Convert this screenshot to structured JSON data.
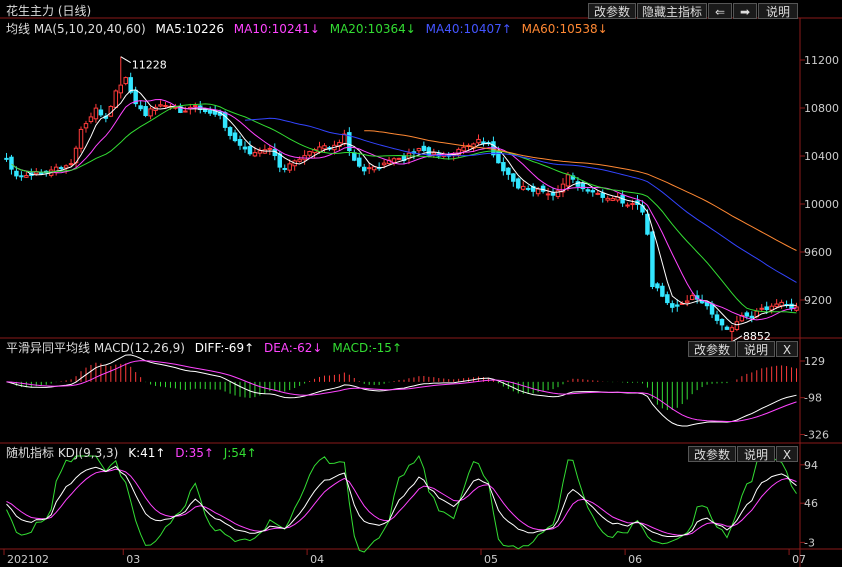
{
  "title": "花生主力 (日线)",
  "toolbar": {
    "edit_params": "改参数",
    "hide_indicator": "隐藏主指标",
    "explain": "说明",
    "left_arrow": "⇐",
    "right_arrow": "➡"
  },
  "main_legend": {
    "ma_label": "均线 MA(5,10,20,40,60)",
    "ma5": "MA5:10226",
    "ma10": "MA10:10241↓",
    "ma20": "MA20:10364↓",
    "ma40": "MA40:10407↑",
    "ma60": "MA60:10538↓"
  },
  "macd_legend": {
    "label": "平滑异同平均线 MACD(12,26,9)",
    "diff": "DIFF:-69↑",
    "dea": "DEA:-62↓",
    "macd": "MACD:-15↑",
    "edit_params": "改参数",
    "explain": "说明",
    "close": "X"
  },
  "kdj_legend": {
    "label": "随机指标 KDJ(9,3,3)",
    "k": "K:41↑",
    "d": "D:35↑",
    "j": "J:54↑",
    "edit_params": "改参数",
    "explain": "说明",
    "close": "X"
  },
  "colors": {
    "up": "#ff3b3b",
    "down": "#33e6ff",
    "ma5": "#ffffff",
    "ma10": "#ff44ff",
    "ma20": "#33dd33",
    "ma40": "#3344ff",
    "ma60": "#ff8833",
    "macd_pos": "#ff3b3b",
    "macd_neg": "#33dd33",
    "diff": "#ffffff",
    "dea": "#ff44ff",
    "kdj_k": "#ffffff",
    "kdj_d": "#ff44ff",
    "kdj_j": "#33dd33",
    "grid": "#8a1a1a"
  },
  "chart_data": [
    {
      "type": "candlestick",
      "ylim": [
        8900,
        11400
      ],
      "yticks": [
        9200,
        9600,
        10000,
        10400,
        10800,
        11200
      ],
      "annotations": [
        {
          "text": "11228",
          "value": 11228,
          "index": 23
        },
        {
          "text": "8852",
          "value": 8852,
          "index": 146
        }
      ],
      "x_month_labels": [
        {
          "label": "202102",
          "index": 0
        },
        {
          "label": "03",
          "index": 24
        },
        {
          "label": "04",
          "index": 61
        },
        {
          "label": "05",
          "index": 96
        },
        {
          "label": "06",
          "index": 125
        },
        {
          "label": "07",
          "index": 158
        }
      ],
      "count": 160,
      "anchors_close": [
        [
          0,
          10380
        ],
        [
          2,
          10240
        ],
        [
          5,
          10250
        ],
        [
          10,
          10300
        ],
        [
          13,
          10330
        ],
        [
          15,
          10620
        ],
        [
          18,
          10780
        ],
        [
          20,
          10720
        ],
        [
          22,
          10930
        ],
        [
          23,
          11000
        ],
        [
          24,
          11050
        ],
        [
          26,
          10830
        ],
        [
          28,
          10750
        ],
        [
          30,
          10800
        ],
        [
          33,
          10830
        ],
        [
          35,
          10750
        ],
        [
          38,
          10830
        ],
        [
          40,
          10780
        ],
        [
          43,
          10740
        ],
        [
          45,
          10560
        ],
        [
          48,
          10450
        ],
        [
          50,
          10420
        ],
        [
          53,
          10480
        ],
        [
          55,
          10300
        ],
        [
          57,
          10320
        ],
        [
          60,
          10420
        ],
        [
          63,
          10460
        ],
        [
          66,
          10480
        ],
        [
          68,
          10570
        ],
        [
          70,
          10360
        ],
        [
          72,
          10290
        ],
        [
          75,
          10300
        ],
        [
          78,
          10370
        ],
        [
          80,
          10380
        ],
        [
          83,
          10460
        ],
        [
          85,
          10420
        ],
        [
          88,
          10400
        ],
        [
          90,
          10420
        ],
        [
          93,
          10500
        ],
        [
          95,
          10530
        ],
        [
          97,
          10500
        ],
        [
          99,
          10330
        ],
        [
          101,
          10230
        ],
        [
          103,
          10150
        ],
        [
          105,
          10120
        ],
        [
          107,
          10130
        ],
        [
          109,
          10080
        ],
        [
          111,
          10100
        ],
        [
          113,
          10250
        ],
        [
          115,
          10150
        ],
        [
          117,
          10100
        ],
        [
          119,
          10100
        ],
        [
          121,
          10030
        ],
        [
          123,
          10050
        ],
        [
          125,
          10000
        ],
        [
          127,
          10000
        ],
        [
          128,
          9930
        ],
        [
          129,
          9760
        ],
        [
          130,
          9320
        ],
        [
          132,
          9250
        ],
        [
          134,
          9130
        ],
        [
          136,
          9170
        ],
        [
          138,
          9220
        ],
        [
          140,
          9180
        ],
        [
          142,
          9100
        ],
        [
          144,
          8990
        ],
        [
          146,
          8950
        ],
        [
          148,
          9080
        ],
        [
          150,
          9060
        ],
        [
          152,
          9120
        ],
        [
          154,
          9150
        ],
        [
          156,
          9180
        ],
        [
          159,
          9130
        ]
      ]
    },
    {
      "type": "macd_histogram",
      "ylim": [
        -360,
        160
      ],
      "yticks": [
        129,
        -98,
        -326
      ],
      "series": [
        "DIFF",
        "DEA",
        "MACD"
      ]
    },
    {
      "type": "kdj",
      "ylim": [
        -10,
        100
      ],
      "yticks": [
        94,
        46,
        -3
      ],
      "series": [
        "K",
        "D",
        "J"
      ]
    }
  ]
}
